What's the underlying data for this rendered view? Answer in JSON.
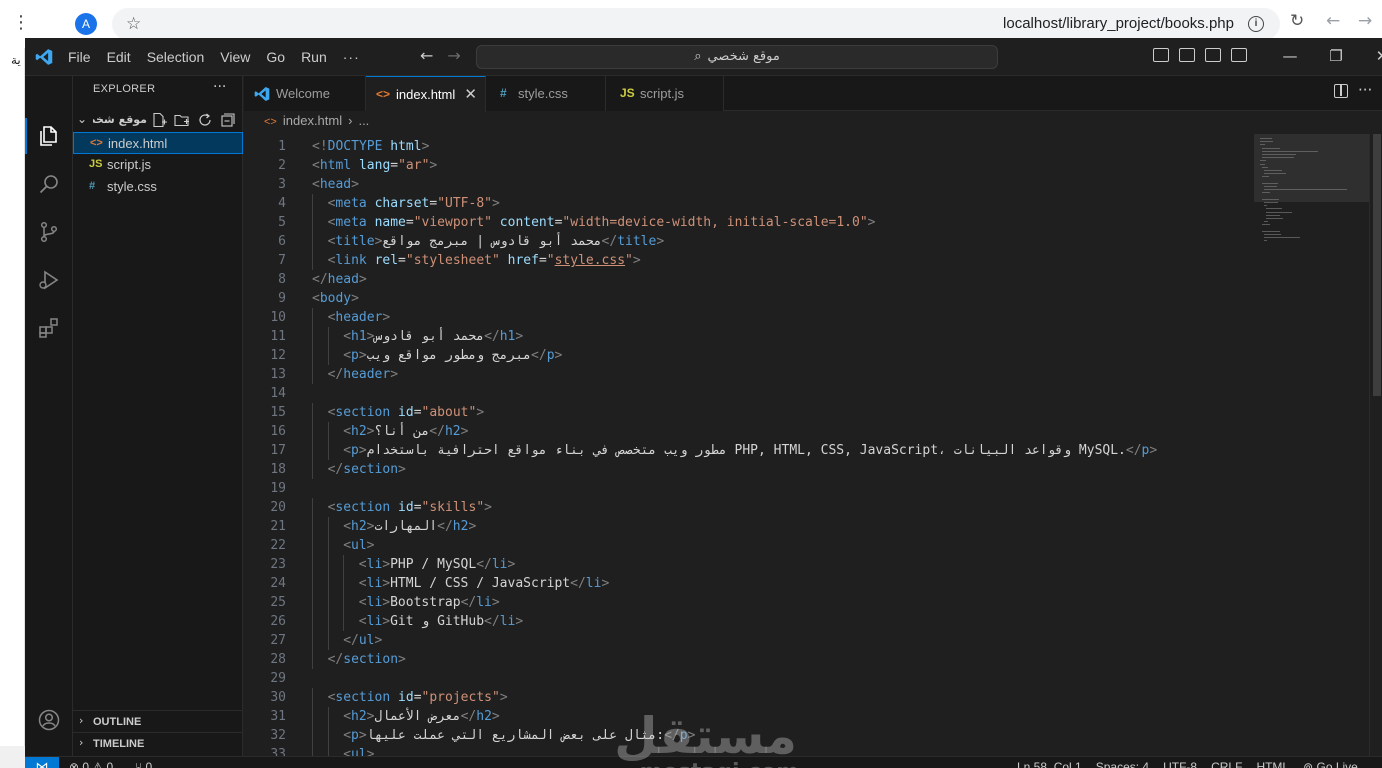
{
  "browser": {
    "profile_initial": "A",
    "url": "localhost/library_project/books.php",
    "page_fragment": "ية"
  },
  "vscode": {
    "menu": [
      "File",
      "Edit",
      "Selection",
      "View",
      "Go",
      "Run",
      "···"
    ],
    "command_center": "موقع شخصي",
    "explorer": {
      "title": "EXPLORER",
      "folder": "موقع شخصي",
      "files": [
        {
          "name": "index.html",
          "icon": "<>",
          "selected": true
        },
        {
          "name": "script.js",
          "icon": "JS",
          "selected": false
        },
        {
          "name": "style.css",
          "icon": "#",
          "selected": false
        }
      ],
      "outline": "OUTLINE",
      "timeline": "TIMELINE"
    },
    "tabs": [
      {
        "label": "Welcome",
        "icon": "vscode-icon"
      },
      {
        "label": "index.html",
        "icon": "<>",
        "active": true
      },
      {
        "label": "style.css",
        "icon": "#"
      },
      {
        "label": "script.js",
        "icon": "JS"
      }
    ],
    "breadcrumb": {
      "file": "index.html",
      "rest": "..."
    },
    "code_lines": [
      {
        "n": 1,
        "i": 0,
        "t": [
          [
            "p",
            "<!"
          ],
          [
            "tg",
            "DOCTYPE "
          ],
          [
            "a",
            "html"
          ],
          [
            "p",
            ">"
          ]
        ]
      },
      {
        "n": 2,
        "i": 0,
        "t": [
          [
            "p",
            "<"
          ],
          [
            "tg",
            "html "
          ],
          [
            "a",
            "lang"
          ],
          [
            "x",
            "="
          ],
          [
            "s",
            "\"ar\""
          ],
          [
            "p",
            ">"
          ]
        ]
      },
      {
        "n": 3,
        "i": 0,
        "t": [
          [
            "p",
            "<"
          ],
          [
            "tg",
            "head"
          ],
          [
            "p",
            ">"
          ]
        ]
      },
      {
        "n": 4,
        "i": 1,
        "t": [
          [
            "p",
            "<"
          ],
          [
            "tg",
            "meta "
          ],
          [
            "a",
            "charset"
          ],
          [
            "x",
            "="
          ],
          [
            "s",
            "\"UTF-8\""
          ],
          [
            "p",
            ">"
          ]
        ]
      },
      {
        "n": 5,
        "i": 1,
        "t": [
          [
            "p",
            "<"
          ],
          [
            "tg",
            "meta "
          ],
          [
            "a",
            "name"
          ],
          [
            "x",
            "="
          ],
          [
            "s",
            "\"viewport\" "
          ],
          [
            "a",
            "content"
          ],
          [
            "x",
            "="
          ],
          [
            "s",
            "\"width=device-width, initial-scale=1.0\""
          ],
          [
            "p",
            ">"
          ]
        ]
      },
      {
        "n": 6,
        "i": 1,
        "t": [
          [
            "p",
            "<"
          ],
          [
            "tg",
            "title"
          ],
          [
            "p",
            ">"
          ],
          [
            "x",
            "محمد أبو قادوس | مبرمج مواقع"
          ],
          [
            "p",
            "</"
          ],
          [
            "tg",
            "title"
          ],
          [
            "p",
            ">"
          ]
        ]
      },
      {
        "n": 7,
        "i": 1,
        "t": [
          [
            "p",
            "<"
          ],
          [
            "tg",
            "link "
          ],
          [
            "a",
            "rel"
          ],
          [
            "x",
            "="
          ],
          [
            "s",
            "\"stylesheet\" "
          ],
          [
            "a",
            "href"
          ],
          [
            "x",
            "="
          ],
          [
            "s",
            "\""
          ],
          [
            "u",
            "style.css"
          ],
          [
            "s",
            "\""
          ],
          [
            "p",
            ">"
          ]
        ]
      },
      {
        "n": 8,
        "i": 0,
        "t": [
          [
            "p",
            "</"
          ],
          [
            "tg",
            "head"
          ],
          [
            "p",
            ">"
          ]
        ]
      },
      {
        "n": 9,
        "i": 0,
        "t": [
          [
            "p",
            "<"
          ],
          [
            "tg",
            "body"
          ],
          [
            "p",
            ">"
          ]
        ]
      },
      {
        "n": 10,
        "i": 1,
        "t": [
          [
            "p",
            "<"
          ],
          [
            "tg",
            "header"
          ],
          [
            "p",
            ">"
          ]
        ]
      },
      {
        "n": 11,
        "i": 2,
        "t": [
          [
            "p",
            "<"
          ],
          [
            "tg",
            "h1"
          ],
          [
            "p",
            ">"
          ],
          [
            "x",
            "محمد أبو قادوس"
          ],
          [
            "p",
            "</"
          ],
          [
            "tg",
            "h1"
          ],
          [
            "p",
            ">"
          ]
        ]
      },
      {
        "n": 12,
        "i": 2,
        "t": [
          [
            "p",
            "<"
          ],
          [
            "tg",
            "p"
          ],
          [
            "p",
            ">"
          ],
          [
            "x",
            "مبرمج ومطور مواقع ويب"
          ],
          [
            "p",
            "</"
          ],
          [
            "tg",
            "p"
          ],
          [
            "p",
            ">"
          ]
        ]
      },
      {
        "n": 13,
        "i": 1,
        "t": [
          [
            "p",
            "</"
          ],
          [
            "tg",
            "header"
          ],
          [
            "p",
            ">"
          ]
        ]
      },
      {
        "n": 14,
        "i": 0,
        "t": []
      },
      {
        "n": 15,
        "i": 1,
        "t": [
          [
            "p",
            "<"
          ],
          [
            "tg",
            "section "
          ],
          [
            "a",
            "id"
          ],
          [
            "x",
            "="
          ],
          [
            "s",
            "\"about\""
          ],
          [
            "p",
            ">"
          ]
        ]
      },
      {
        "n": 16,
        "i": 2,
        "t": [
          [
            "p",
            "<"
          ],
          [
            "tg",
            "h2"
          ],
          [
            "p",
            ">"
          ],
          [
            "x",
            "من أنا؟"
          ],
          [
            "p",
            "</"
          ],
          [
            "tg",
            "h2"
          ],
          [
            "p",
            ">"
          ]
        ]
      },
      {
        "n": 17,
        "i": 2,
        "t": [
          [
            "p",
            "<"
          ],
          [
            "tg",
            "p"
          ],
          [
            "p",
            ">"
          ],
          [
            "x",
            "مطور ويب متخصص في بناء مواقع احترافية باستخدام PHP, HTML, CSS, JavaScript، وقواعد البيانات MySQL."
          ],
          [
            "p",
            "</"
          ],
          [
            "tg",
            "p"
          ],
          [
            "p",
            ">"
          ]
        ]
      },
      {
        "n": 18,
        "i": 1,
        "t": [
          [
            "p",
            "</"
          ],
          [
            "tg",
            "section"
          ],
          [
            "p",
            ">"
          ]
        ]
      },
      {
        "n": 19,
        "i": 0,
        "t": []
      },
      {
        "n": 20,
        "i": 1,
        "t": [
          [
            "p",
            "<"
          ],
          [
            "tg",
            "section "
          ],
          [
            "a",
            "id"
          ],
          [
            "x",
            "="
          ],
          [
            "s",
            "\"skills\""
          ],
          [
            "p",
            ">"
          ]
        ]
      },
      {
        "n": 21,
        "i": 2,
        "t": [
          [
            "p",
            "<"
          ],
          [
            "tg",
            "h2"
          ],
          [
            "p",
            ">"
          ],
          [
            "x",
            "المهارات"
          ],
          [
            "p",
            "</"
          ],
          [
            "tg",
            "h2"
          ],
          [
            "p",
            ">"
          ]
        ]
      },
      {
        "n": 22,
        "i": 2,
        "t": [
          [
            "p",
            "<"
          ],
          [
            "tg",
            "ul"
          ],
          [
            "p",
            ">"
          ]
        ]
      },
      {
        "n": 23,
        "i": 3,
        "t": [
          [
            "p",
            "<"
          ],
          [
            "tg",
            "li"
          ],
          [
            "p",
            ">"
          ],
          [
            "x",
            "PHP / MySQL"
          ],
          [
            "p",
            "</"
          ],
          [
            "tg",
            "li"
          ],
          [
            "p",
            ">"
          ]
        ]
      },
      {
        "n": 24,
        "i": 3,
        "t": [
          [
            "p",
            "<"
          ],
          [
            "tg",
            "li"
          ],
          [
            "p",
            ">"
          ],
          [
            "x",
            "HTML / CSS / JavaScript"
          ],
          [
            "p",
            "</"
          ],
          [
            "tg",
            "li"
          ],
          [
            "p",
            ">"
          ]
        ]
      },
      {
        "n": 25,
        "i": 3,
        "t": [
          [
            "p",
            "<"
          ],
          [
            "tg",
            "li"
          ],
          [
            "p",
            ">"
          ],
          [
            "x",
            "Bootstrap"
          ],
          [
            "p",
            "</"
          ],
          [
            "tg",
            "li"
          ],
          [
            "p",
            ">"
          ]
        ]
      },
      {
        "n": 26,
        "i": 3,
        "t": [
          [
            "p",
            "<"
          ],
          [
            "tg",
            "li"
          ],
          [
            "p",
            ">"
          ],
          [
            "x",
            "Git و GitHub"
          ],
          [
            "p",
            "</"
          ],
          [
            "tg",
            "li"
          ],
          [
            "p",
            ">"
          ]
        ]
      },
      {
        "n": 27,
        "i": 2,
        "t": [
          [
            "p",
            "</"
          ],
          [
            "tg",
            "ul"
          ],
          [
            "p",
            ">"
          ]
        ]
      },
      {
        "n": 28,
        "i": 1,
        "t": [
          [
            "p",
            "</"
          ],
          [
            "tg",
            "section"
          ],
          [
            "p",
            ">"
          ]
        ]
      },
      {
        "n": 29,
        "i": 0,
        "t": []
      },
      {
        "n": 30,
        "i": 1,
        "t": [
          [
            "p",
            "<"
          ],
          [
            "tg",
            "section "
          ],
          [
            "a",
            "id"
          ],
          [
            "x",
            "="
          ],
          [
            "s",
            "\"projects\""
          ],
          [
            "p",
            ">"
          ]
        ]
      },
      {
        "n": 31,
        "i": 2,
        "t": [
          [
            "p",
            "<"
          ],
          [
            "tg",
            "h2"
          ],
          [
            "p",
            ">"
          ],
          [
            "x",
            "معرض الأعمال"
          ],
          [
            "p",
            "</"
          ],
          [
            "tg",
            "h2"
          ],
          [
            "p",
            ">"
          ]
        ]
      },
      {
        "n": 32,
        "i": 2,
        "t": [
          [
            "p",
            "<"
          ],
          [
            "tg",
            "p"
          ],
          [
            "p",
            ">"
          ],
          [
            "x",
            "مثال على بعض المشاريع التي عملت عليها:"
          ],
          [
            "p",
            "</"
          ],
          [
            "tg",
            "p"
          ],
          [
            "p",
            ">"
          ]
        ]
      },
      {
        "n": 33,
        "i": 2,
        "t": [
          [
            "p",
            "<"
          ],
          [
            "tg",
            "ul"
          ],
          [
            "p",
            ">"
          ]
        ]
      }
    ],
    "status": {
      "problems": "⊗ 0 ⚠ 0",
      "ports": "⑂ 0",
      "items": [
        "Ln 58, Col 1",
        "Spaces: 4",
        "UTF-8",
        "CRLF",
        "HTML",
        "⊚ Go Live"
      ]
    },
    "watermark": {
      "arabic": "مستقل",
      "latin": "mostaqi.com"
    }
  },
  "colors": {
    "editor_bg": "#1f1f1f",
    "accent": "#0078d4",
    "tag": "#569cd6",
    "attr": "#9cdcfe",
    "string": "#ce9178",
    "punct": "#808080",
    "html_icon": "#e37933",
    "js_icon": "#cbcb41",
    "css_icon": "#519aba"
  }
}
